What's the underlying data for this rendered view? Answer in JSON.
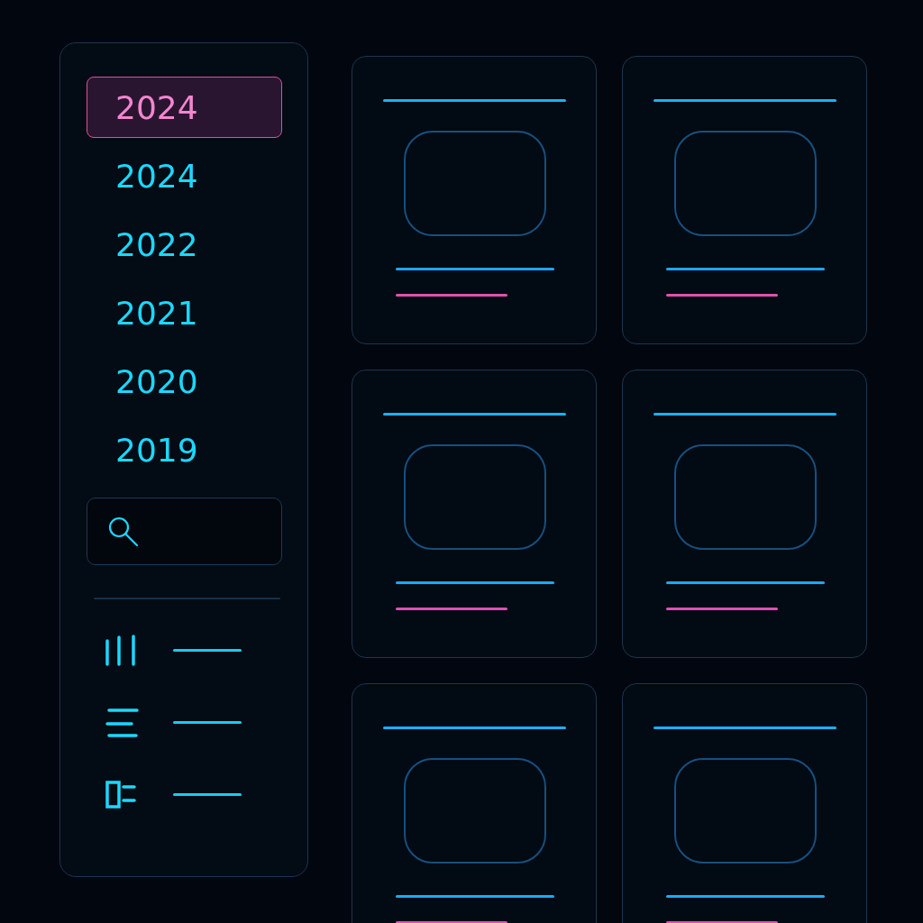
{
  "years": [
    {
      "label": "2024",
      "selected": true
    },
    {
      "label": "2024",
      "selected": false
    },
    {
      "label": "2022",
      "selected": false
    },
    {
      "label": "2021",
      "selected": false
    },
    {
      "label": "2020",
      "selected": false
    },
    {
      "label": "2019",
      "selected": false
    }
  ],
  "tools": [
    {
      "kind": "bars"
    },
    {
      "kind": "lines"
    },
    {
      "kind": "panel"
    }
  ],
  "cards": [
    {
      "kind": "placeholder"
    },
    {
      "kind": "placeholder"
    },
    {
      "kind": "placeholder"
    },
    {
      "kind": "placeholder"
    },
    {
      "kind": "placeholder"
    },
    {
      "kind": "placeholder"
    }
  ]
}
